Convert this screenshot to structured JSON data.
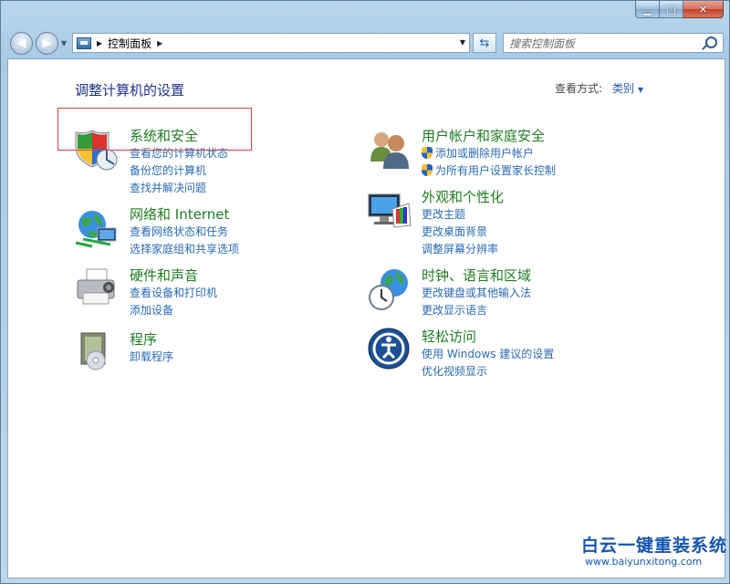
{
  "address_bar": {
    "path": "控制面板"
  },
  "search": {
    "placeholder": "搜索控制面板"
  },
  "content": {
    "title": "调整计算机的设置",
    "view_by_label": "查看方式:",
    "view_by_value": "类别"
  },
  "categories": [
    {
      "title": "系统和安全",
      "icon": "shield-icon",
      "links": [
        "查看您的计算机状态",
        "备份您的计算机",
        "查找并解决问题"
      ]
    },
    {
      "title": "网络和 Internet",
      "icon": "network-globe-icon",
      "links": [
        "查看网络状态和任务",
        "选择家庭组和共享选项"
      ]
    },
    {
      "title": "硬件和声音",
      "icon": "printer-icon",
      "links": [
        "查看设备和打印机",
        "添加设备"
      ]
    },
    {
      "title": "程序",
      "icon": "programs-icon",
      "links": [
        "卸载程序"
      ]
    },
    {
      "title": "用户帐户和家庭安全",
      "icon": "users-icon",
      "links": [
        "添加或删除用户帐户",
        "为所有用户设置家长控制"
      ]
    },
    {
      "title": "外观和个性化",
      "icon": "display-palette-icon",
      "links": [
        "更改主题",
        "更改桌面背景",
        "调整屏幕分辨率"
      ]
    },
    {
      "title": "时钟、语言和区域",
      "icon": "clock-globe-icon",
      "links": [
        "更改键盘或其他输入法",
        "更改显示语言"
      ]
    },
    {
      "title": "轻松访问",
      "icon": "ease-of-access-icon",
      "links": [
        "使用 Windows 建议的设置",
        "优化视频显示"
      ]
    }
  ],
  "watermark": {
    "title": "白云一键重装系统",
    "url": "www.baiyunxitong.com"
  },
  "colors": {
    "category_title": "#1f7c22",
    "link": "#2a6bb3",
    "page_title": "#1e3287",
    "highlight": "#e04040"
  }
}
